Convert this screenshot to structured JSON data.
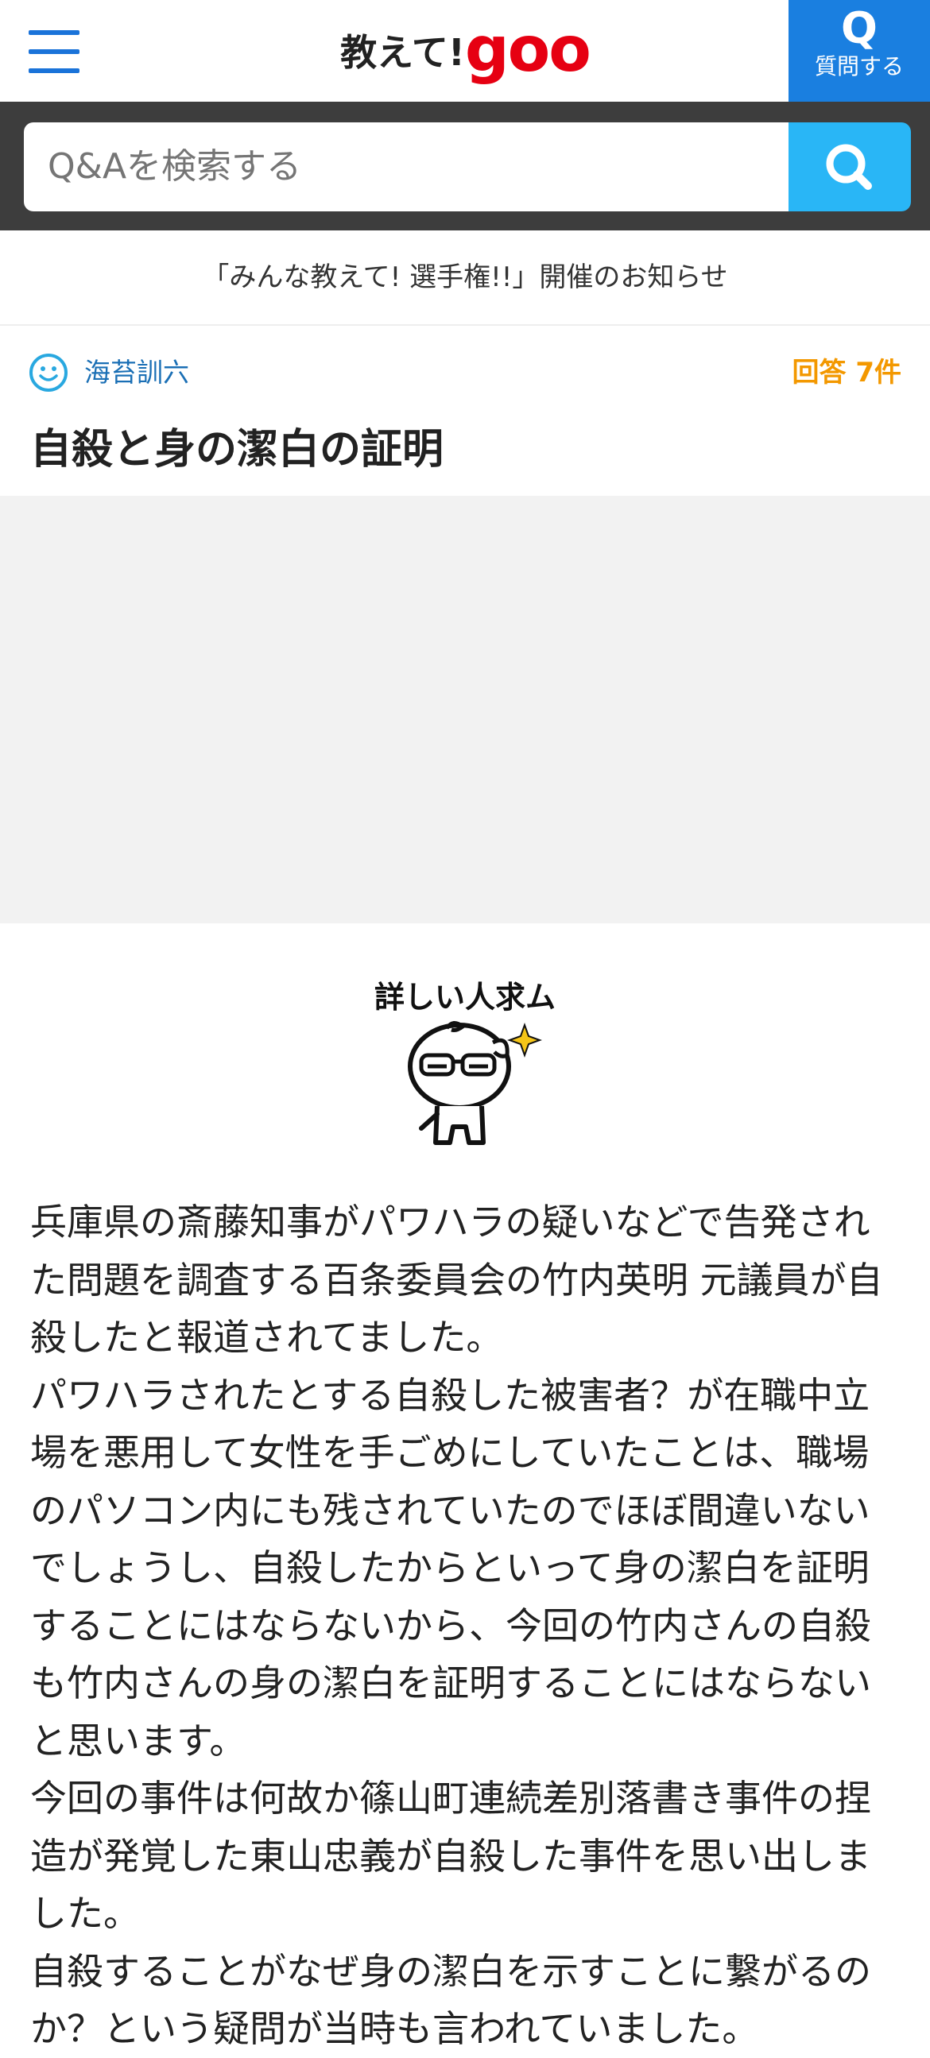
{
  "header": {
    "logo_text": "教えて!",
    "logo_brand": "goo",
    "ask_icon": "Q",
    "ask_label": "質問する",
    "menu_icon": "hamburger-menu-icon"
  },
  "search": {
    "placeholder": "Q&Aを検索する",
    "button_icon": "search-icon"
  },
  "notice": {
    "text": "「みんな教えて! 選手権!!」開催のお知らせ"
  },
  "question": {
    "author": "海苔訓六",
    "answers_label": "回答 7件",
    "title": "自殺と身の潔白の証明",
    "sticker_caption": "詳しい人求ム",
    "body": [
      "兵庫県の斎藤知事がパワハラの疑いなどで告発された問題を調査する百条委員会の竹内英明 元議員が自殺したと報道されてました。",
      "パワハラされたとする自殺した被害者？が在職中立場を悪用して女性を手ごめにしていたことは、職場のパソコン内にも残されていたのでほぼ間違いないでしょうし、自殺したからといって身の潔白を証明することにはならないから、今回の竹内さんの自殺も竹内さんの身の潔白を証明することにはならないと思います。",
      "今回の事件は何故か篠山町連続差別落書き事件の捏造が発覚した東山忠義が自殺した事件を思い出しました。",
      "自殺することがなぜ身の潔白を示すことに繋がるのか？という疑問が当時も言われていました。"
    ]
  },
  "colors": {
    "brand_red": "#e60012",
    "brand_blue": "#1a7fe0",
    "search_blue": "#29b6f6",
    "answer_orange": "#f39800",
    "author_blue": "#1a6fb5"
  }
}
